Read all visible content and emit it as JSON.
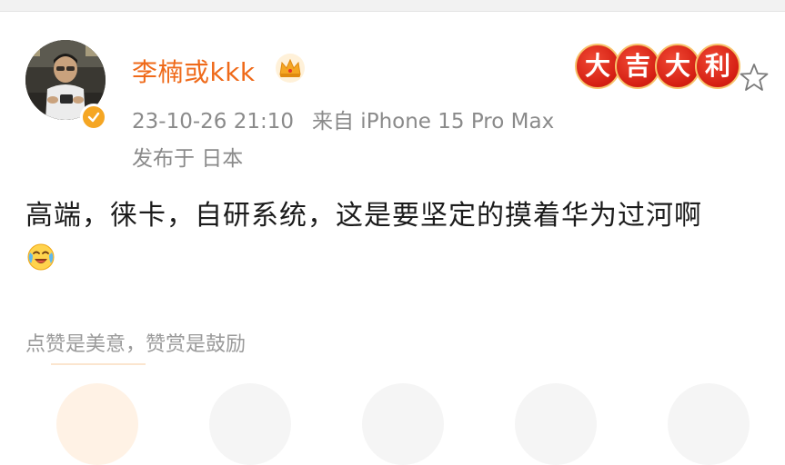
{
  "post": {
    "author": {
      "name": "李楠或kkk",
      "verified_icon": "verified-badge-icon",
      "crown_icon": "crown-icon"
    },
    "timestamp": "23-10-26 21:10",
    "source": "来自 iPhone 15 Pro Max",
    "location": "发布于 日本",
    "content": "高端，徕卡，自研系统，这是要坚定的摸着华为过河啊",
    "emoji": "cry-laugh-emoji",
    "fortune_badge": [
      "大",
      "吉",
      "大",
      "利"
    ],
    "favorite_icon": "star-outline-icon",
    "reward_hint": "点赞是美意，赞赏是鼓励"
  },
  "colors": {
    "username": "#ef6a1a",
    "meta": "#8a8a8a",
    "text": "#1b1b1b",
    "badge_red": "#d41e12",
    "verified": "#f5a623"
  }
}
